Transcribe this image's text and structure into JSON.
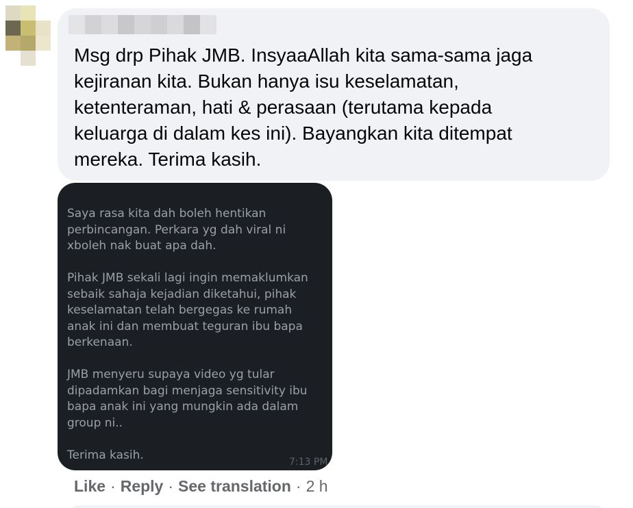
{
  "comment": {
    "author_name": "",
    "text_lines": [
      "Msg drp Pihak JMB. InsyaaAllah kita sama-sama jaga",
      "kejiranan kita. Bukan hanya isu keselamatan,",
      "ketenteraman, hati & perasaan (terutama kepada",
      "keluarga di dalam kes ini). Bayangkan kita ditempat",
      "mereka. Terima kasih."
    ]
  },
  "attachment": {
    "message_lines": [
      "Saya rasa kita dah boleh hentikan",
      "perbincangan. Perkara yg dah viral ni",
      "xboleh nak buat apa dah.",
      "",
      "Pihak JMB sekali lagi ingin memaklumkan",
      "sebaik sahaja kejadian diketahui, pihak",
      "keselamatan telah bergegas ke rumah",
      "anak ini dan membuat teguran ibu bapa",
      "berkenaan.",
      "",
      "JMB menyeru supaya video yg tular",
      "dipadamkan bagi menjaga sensitivity ibu",
      "bapa anak ini yang mungkin ada dalam",
      "group ni..",
      "",
      "Terima kasih."
    ],
    "timestamp": "7:13 PM"
  },
  "actions": {
    "like_label": "Like",
    "reply_label": "Reply",
    "see_translation_label": "See translation",
    "separator": "·",
    "time_ago": "2 h"
  },
  "colors": {
    "bubble_bg": "#f0f2f5",
    "text_primary": "#050505",
    "text_secondary": "#65676b",
    "attachment_bg": "#1b1f24",
    "attachment_text": "#9aa0a6"
  }
}
